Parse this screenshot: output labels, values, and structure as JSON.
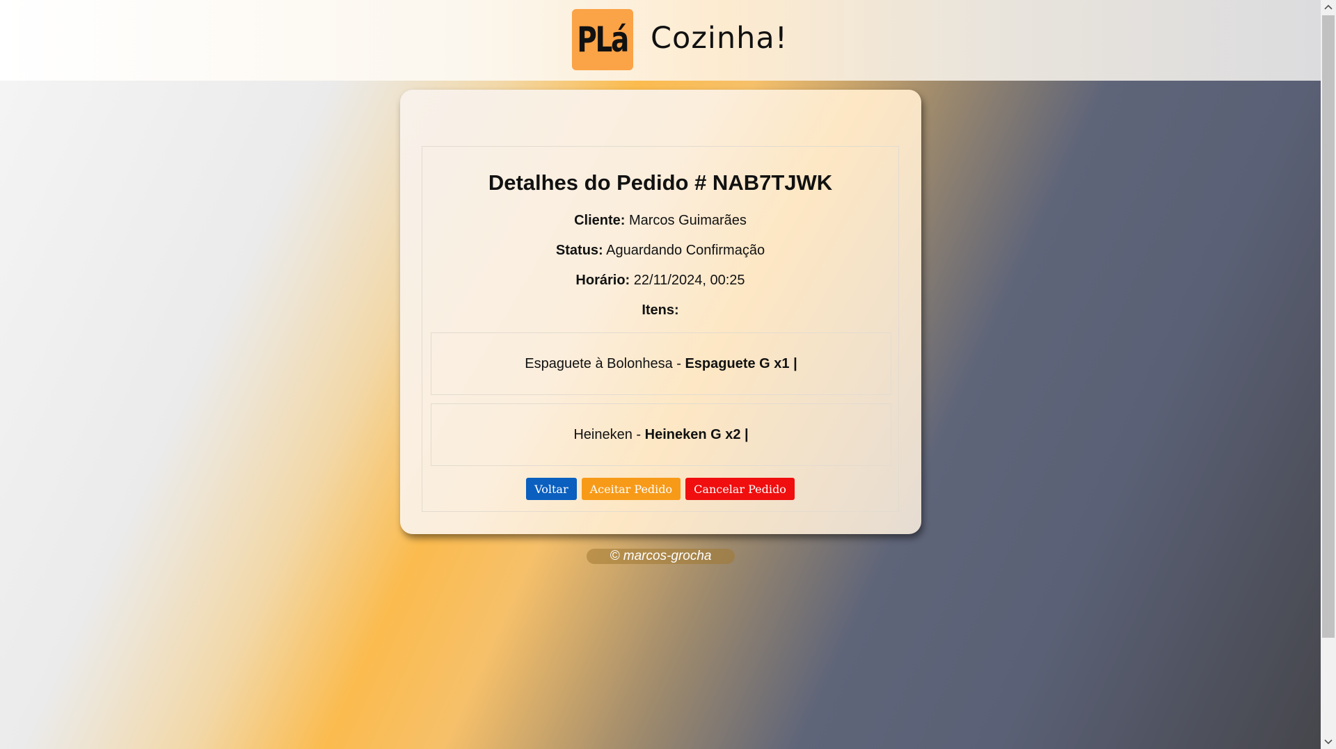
{
  "header": {
    "logo_text": "PLá",
    "brand": "Cozinha!"
  },
  "order": {
    "title": "Detalhes do Pedido # NAB7TJWK",
    "client_label": "Cliente:",
    "client_value": "Marcos Guimarães",
    "status_label": "Status:",
    "status_value": "Aguardando Confirmação",
    "time_label": "Horário:",
    "time_value": "22/11/2024, 00:25",
    "items_label": "Itens:",
    "items": [
      {
        "name": "Espaguete à Bolonhesa - ",
        "detail": "Espaguete G x1 |"
      },
      {
        "name": "Heineken - ",
        "detail": "Heineken G x2 |"
      }
    ]
  },
  "buttons": {
    "back": "Voltar",
    "accept": "Aceitar Pedido",
    "cancel": "Cancelar Pedido"
  },
  "footer": {
    "text": "© marcos-grocha"
  },
  "icons": {
    "scroll_up": "chevron-up-icon",
    "scroll_down": "chevron-down-icon"
  },
  "colors": {
    "logo": "#fba347",
    "back_button": "#0a5fbf",
    "accept_button": "#f79a18",
    "cancel_button": "#f00e0e"
  }
}
